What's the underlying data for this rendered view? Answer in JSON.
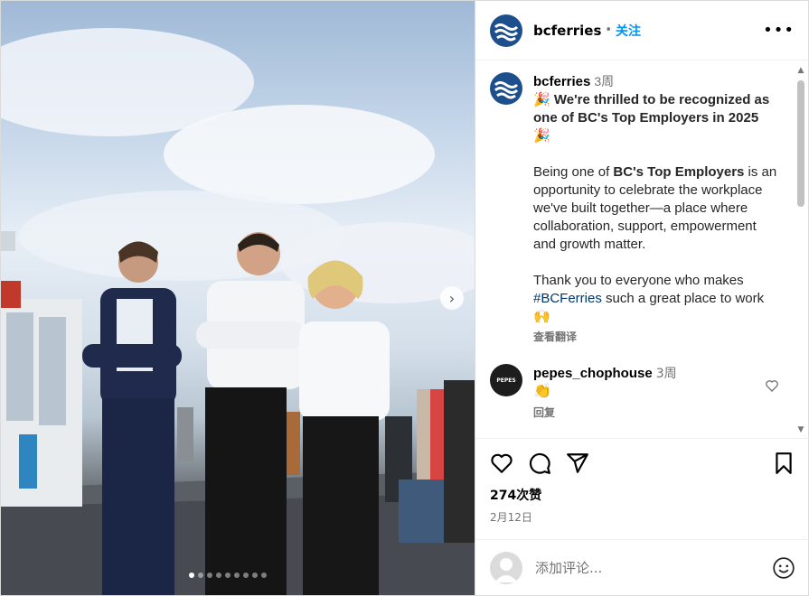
{
  "post": {
    "username": "bcferries",
    "follow_label": "关注",
    "separator": "•",
    "more_label": "•••",
    "carousel_next": "›",
    "carousel_dots": 9,
    "carousel_active_index": 0
  },
  "caption": {
    "username": "bcferries",
    "time": "3周",
    "emoji": "🎉",
    "headline": "We're thrilled to be recognized as one of BC's Top Employers in 2025",
    "p1_prefix": "Being one of ",
    "p1_bold": "BC's Top Employers",
    "p1_rest": " is an opportunity to celebrate the workplace we've built together—a place where collaboration, support, empowerment and growth matter.",
    "p2_prefix": "Thank you to everyone who makes ",
    "hashtag": "#BCFerries",
    "p2_rest": " such a great place to work ",
    "p2_emoji": "🙌",
    "translate": "查看翻译"
  },
  "comment": {
    "username": "pepes_chophouse",
    "time": "3周",
    "text": "👏",
    "avatar_text": "PEPES",
    "reply": "回复"
  },
  "actions": {
    "likes": "274次赞",
    "date": "2月12日"
  },
  "add_comment": {
    "placeholder": "添加评论..."
  },
  "colors": {
    "brand": "#1c4f8c",
    "link": "#0095f6",
    "hashtag": "#00376b",
    "muted": "#737373"
  }
}
